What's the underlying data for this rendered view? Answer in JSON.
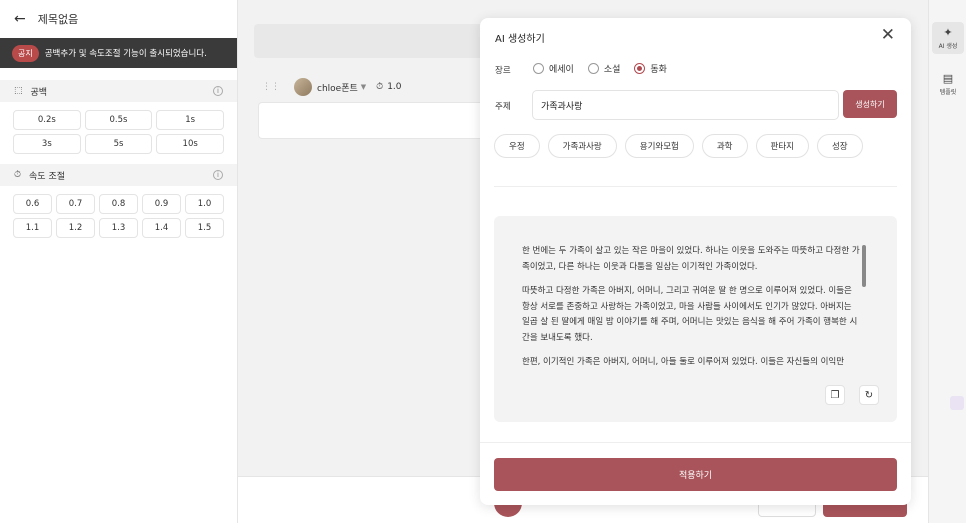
{
  "doc": {
    "title": "제목없음"
  },
  "notice": {
    "badge": "공지",
    "text": "공백추가 및 속도조절 기능이 출시되었습니다."
  },
  "gap": {
    "label": "공백",
    "options": [
      "0.2s",
      "0.5s",
      "1s",
      "3s",
      "5s",
      "10s"
    ]
  },
  "speed": {
    "label": "속도 조절",
    "options": [
      "0.6",
      "0.7",
      "0.8",
      "0.9",
      "1.0",
      "1.1",
      "1.2",
      "1.3",
      "1.4",
      "1.5"
    ]
  },
  "editor": {
    "voice_name": "chloe폰트",
    "speed_value": "1.0"
  },
  "rail": {
    "ai_label": "AI 생성",
    "template_label": "템플릿"
  },
  "modal": {
    "title": "AI 생성하기",
    "genre_label": "장르",
    "genres": [
      "에세이",
      "소설",
      "동화"
    ],
    "selected_genre": "동화",
    "topic_label": "주제",
    "topic_value": "가족과사랑",
    "generate_label": "생성하기",
    "tags": [
      "우정",
      "가족과사랑",
      "용기와모험",
      "과학",
      "판타지",
      "성장"
    ],
    "result_paragraphs": [
      "한 번에는 두 가족이 살고 있는 작은 마을이 있었다. 하나는 이웃을 도와주는 따뜻하고 다정한 가족이었고, 다른 하나는 이웃과 다툼을 일삼는 이기적인 가족이었다.",
      "따뜻하고 다정한 가족은 아버지, 어머니, 그리고 귀여운 딸 한 명으로 이루어져 있었다. 이들은 항상 서로를 존중하고 사랑하는 가족이었고, 마을 사람들 사이에서도 인기가 많았다. 아버지는 일곱 살 된 딸에게 매일 밤 이야기를 해 주며, 어머니는 맛있는 음식을 해 주어 가족이 행복한 시간을 보내도록 했다.",
      "한편, 이기적인 가족은 아버지, 어머니, 아들 둘로 이루어져 있었다. 이들은 자신들의 이익만"
    ],
    "apply_label": "적용하기"
  },
  "colors": {
    "accent": "#a8545a",
    "notice_bg": "#3a3a3a"
  }
}
